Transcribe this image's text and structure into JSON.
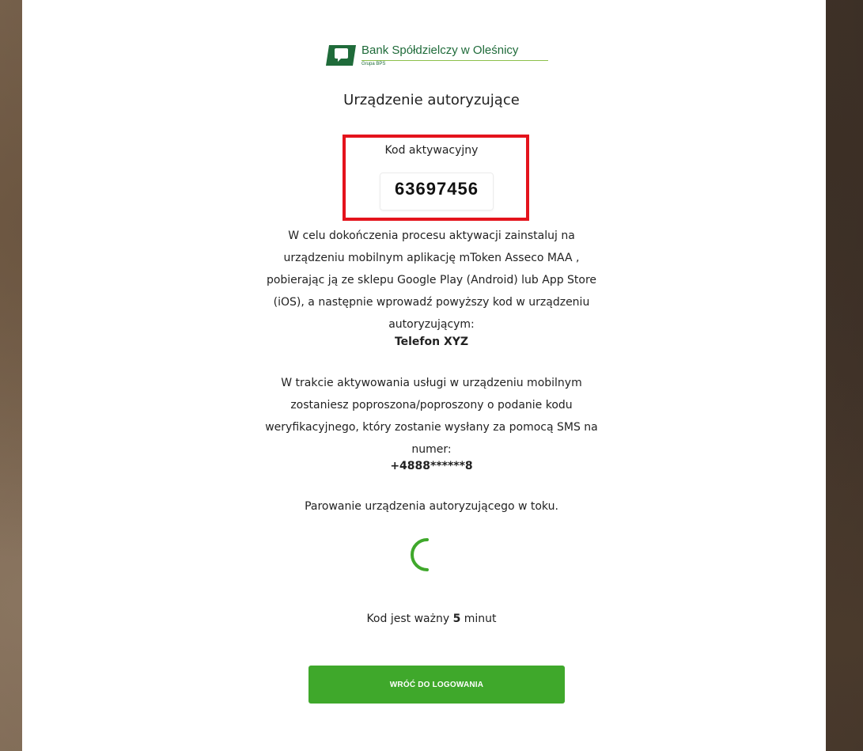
{
  "colors": {
    "accent_green": "#3fa82b",
    "highlight_red": "#e4131c",
    "brand_green": "#1f6b3a"
  },
  "logo": {
    "icon": "bank-logo-mark-icon",
    "name": "Bank Spółdzielczy w Oleśnicy",
    "group": "Grupa BPS"
  },
  "page": {
    "title": "Urządzenie autoryzujące"
  },
  "activation": {
    "label": "Kod aktywacyjny",
    "code": "63697456"
  },
  "instructions": {
    "lines": [
      "W celu dokończenia procesu aktywacji zainstaluj na",
      "urządzeniu mobilnym aplikację mToken Asseco MAA ,",
      "pobierając ją ze sklepu Google Play (Android) lub App Store",
      "(iOS), a następnie wprowadź powyższy kod w urządzeniu",
      "autoryzującym:"
    ],
    "device": "Telefon XYZ"
  },
  "sms_info": {
    "lines": [
      "W trakcie aktywowania usługi w urządzeniu mobilnym",
      "zostaniesz poproszona/poproszony o podanie kodu",
      "weryfikacyjnego, który zostanie wysłany za pomocą SMS na",
      "numer:"
    ],
    "phone": "+4888******8"
  },
  "status": {
    "text": "Parowanie urządzenia autoryzującego w toku.",
    "spinner_icon": "loading-spinner-icon"
  },
  "validity": {
    "prefix": "Kod jest ważny",
    "minutes": "5",
    "suffix": "minut"
  },
  "buttons": {
    "back_label": "WRÓĆ DO LOGOWANIA"
  }
}
